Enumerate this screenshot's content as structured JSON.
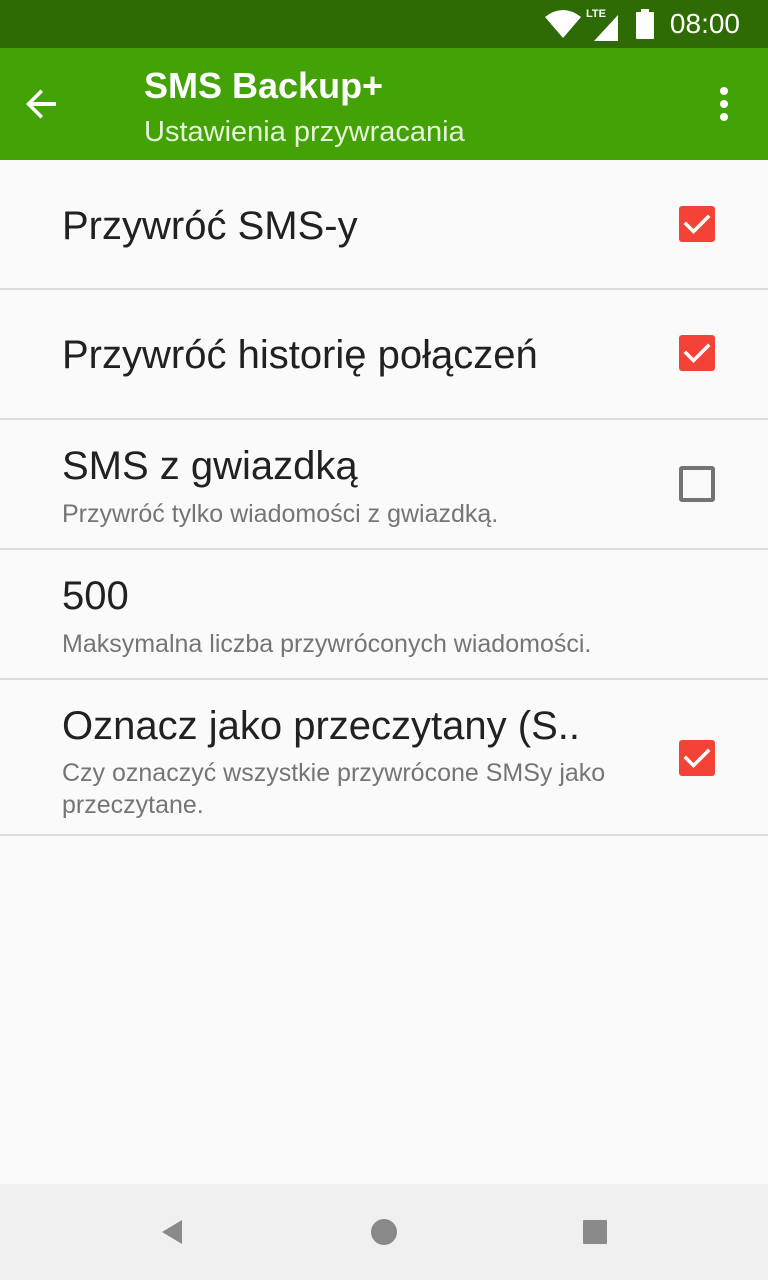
{
  "status_bar": {
    "time": "08:00",
    "network_label": "LTE",
    "icons": [
      "wifi-icon",
      "signal-icon",
      "battery-icon"
    ]
  },
  "app_bar": {
    "title": "SMS Backup+",
    "subtitle": "Ustawienia przywracania",
    "back_icon": "arrow-back-icon",
    "menu_icon": "more-vert-icon",
    "color": "#43a205"
  },
  "preferences": [
    {
      "title": "Przywróć SMS-y",
      "summary": "",
      "control": "checkbox",
      "checked": true
    },
    {
      "title": "Przywróć historię połączeń",
      "summary": "",
      "control": "checkbox",
      "checked": true
    },
    {
      "title": "SMS z gwiazdką",
      "summary": "Przywróć tylko wiadomości z gwiazdką.",
      "control": "checkbox",
      "checked": false
    },
    {
      "title": "500",
      "summary": "Maksymalna liczba przywróconych wiadomości.",
      "control": "none"
    },
    {
      "title": "Oznacz jako przeczytany (S..",
      "summary": "Czy oznaczyć wszystkie przywrócone SMSy jako przeczytane.",
      "control": "checkbox",
      "checked": true
    }
  ],
  "nav_bar": {
    "buttons": [
      "back-triangle-icon",
      "home-circle-icon",
      "recents-square-icon"
    ]
  },
  "colors": {
    "status_bar": "#2e6b04",
    "checkbox_checked": "#f44336"
  }
}
